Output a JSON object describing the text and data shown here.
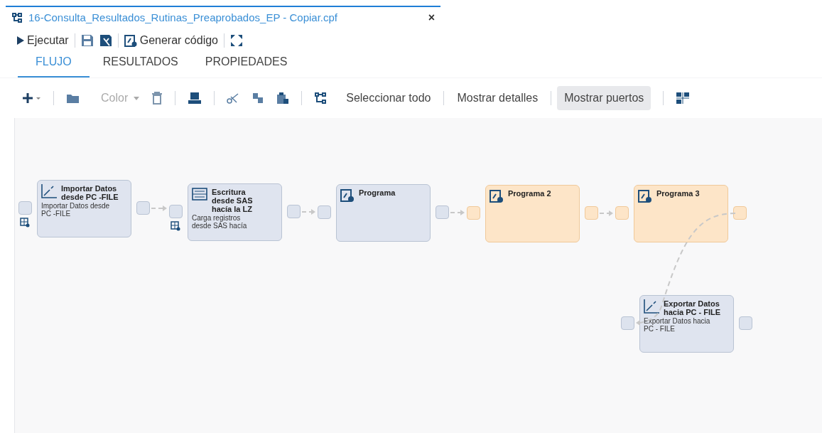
{
  "document_tab": {
    "title": "16-Consulta_Resultados_Rutinas_Preaprobados_EP - Copiar.cpf",
    "close": "×"
  },
  "main_toolbar": {
    "run": "Ejecutar",
    "generate_code": "Generar código"
  },
  "tabs": [
    {
      "label": "FLUJO",
      "selected": true
    },
    {
      "label": "RESULTADOS",
      "selected": false
    },
    {
      "label": "PROPIEDADES",
      "selected": false
    }
  ],
  "flow_toolbar": {
    "color": {
      "label": "Color",
      "disabled": true
    },
    "buttons": [
      {
        "label": "Seleccionar todo",
        "selected": false
      },
      {
        "label": "Mostrar detalles",
        "selected": false
      },
      {
        "label": "Mostrar puertos",
        "selected": true
      }
    ]
  },
  "nodes": [
    {
      "kind": "import",
      "title": "Importar Datos desde PC -FILE",
      "description": "Importar Datos desde PC -FILE",
      "selected": false,
      "table_port": true
    },
    {
      "kind": "write",
      "title": "Escritura desde SAS hacía la LZ",
      "description": "Carga registros desde SAS hacía",
      "selected": false,
      "table_port": true
    },
    {
      "kind": "program",
      "title": "Programa",
      "selected": false,
      "table_port": false
    },
    {
      "kind": "program",
      "title": "Programa 2",
      "selected": true,
      "table_port": false
    },
    {
      "kind": "program",
      "title": "Programa 3",
      "selected": true,
      "table_port": false
    },
    {
      "kind": "export",
      "title": "Exportar Datos hacia PC - FILE",
      "description": "Exportar Datos hacia PC - FILE",
      "selected": false,
      "table_port": false
    }
  ]
}
